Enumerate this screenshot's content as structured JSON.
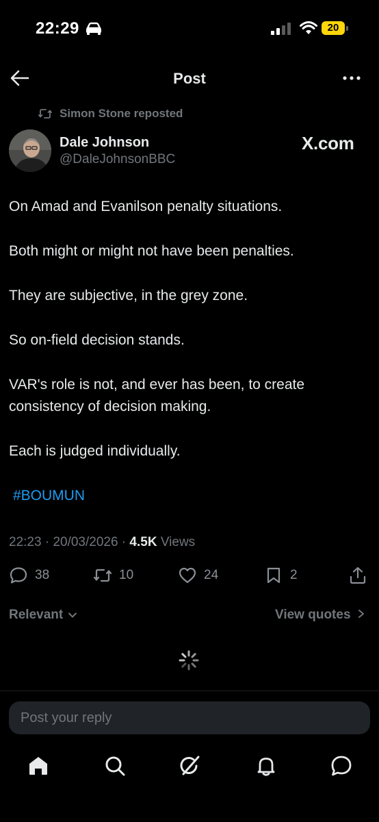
{
  "status_bar": {
    "time": "22:29",
    "battery": "20"
  },
  "header": {
    "title": "Post"
  },
  "repost": {
    "text": "Simon Stone reposted"
  },
  "author": {
    "name": "Dale Johnson",
    "handle": "@DaleJohnsonBBC",
    "source_label": "X.com"
  },
  "post": {
    "paragraphs": [
      "On Amad and Evanilson penalty situations.",
      "Both might or might not have been penalties.",
      "They are subjective, in the grey zone.",
      "So on-field decision stands.",
      "VAR's role is not, and ever has been, to create consistency of decision making.",
      "Each is judged individually."
    ],
    "hashtag": "#BOUMUN"
  },
  "meta": {
    "time": "22:23",
    "date": "20/03/2026",
    "views_count": "4.5K",
    "views_label": "Views"
  },
  "actions": {
    "replies": "38",
    "reposts": "10",
    "likes": "24",
    "bookmarks": "2"
  },
  "replies_filter": {
    "sort_label": "Relevant",
    "view_quotes_label": "View quotes"
  },
  "reply_composer": {
    "placeholder": "Post your reply"
  },
  "bottom_nav": [
    "home-icon",
    "search-icon",
    "grok-icon",
    "notifications-icon",
    "messages-icon"
  ],
  "colors": {
    "background": "#000000",
    "accent": "#1d9bf0",
    "secondary_text": "#71767b",
    "battery": "#ffd60a"
  }
}
